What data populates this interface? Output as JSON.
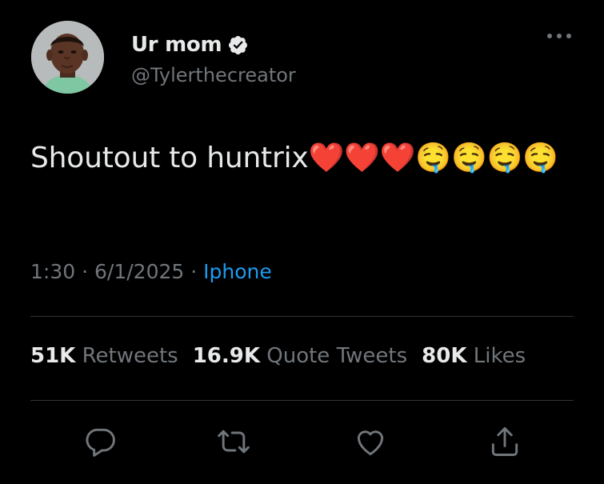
{
  "user": {
    "display_name": "Ur mom",
    "handle": "@Tylerthecreator",
    "verified": true
  },
  "tweet": {
    "text": "Shoutout to huntrix❤️❤️❤️🤤🤤🤤🤤",
    "time": "1:30",
    "date": "6/1/2025",
    "source": "Iphone"
  },
  "stats": {
    "retweets_count": "51K",
    "retweets_label": "Retweets",
    "quotes_count": "16.9K",
    "quotes_label": "Quote Tweets",
    "likes_count": "80K",
    "likes_label": "Likes"
  },
  "actions": {
    "icons": [
      "reply-icon",
      "retweet-icon",
      "like-icon",
      "share-icon"
    ]
  },
  "colors": {
    "background": "#000000",
    "text": "#e7e9ea",
    "secondary": "#71767b",
    "link": "#1d9bf0",
    "divider": "#2f3336"
  }
}
